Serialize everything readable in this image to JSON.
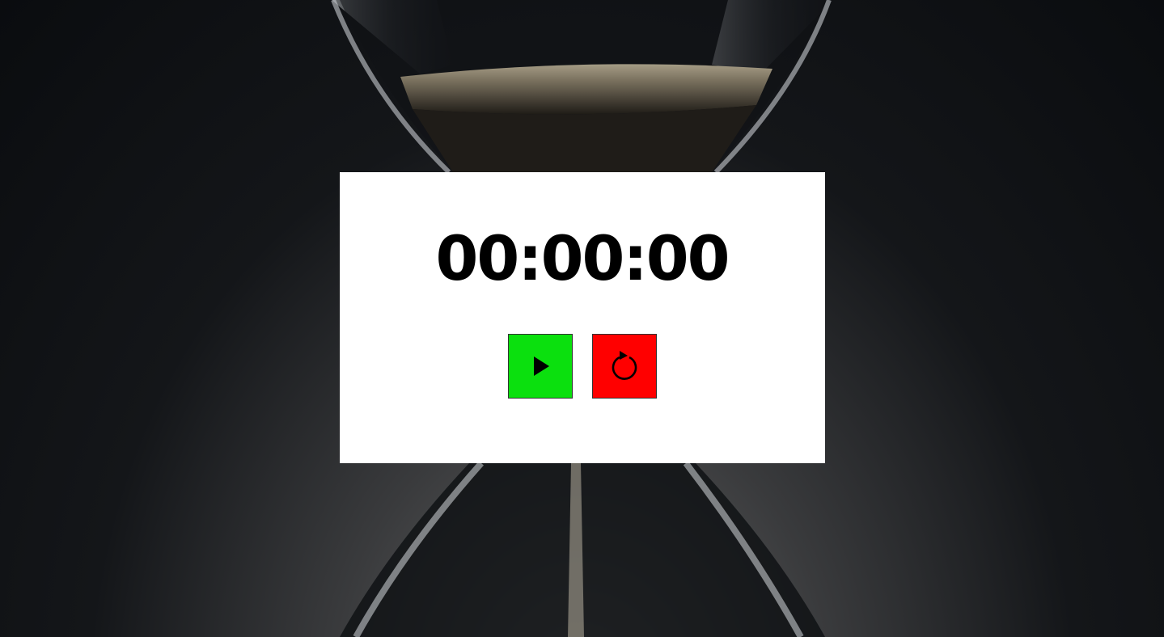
{
  "timer": {
    "display": "00:00:00"
  },
  "controls": {
    "start": {
      "icon": "play-icon",
      "color": "#0be00e"
    },
    "reset": {
      "icon": "reset-icon",
      "color": "#ff0000"
    }
  },
  "background": {
    "icon": "hourglass-image"
  }
}
